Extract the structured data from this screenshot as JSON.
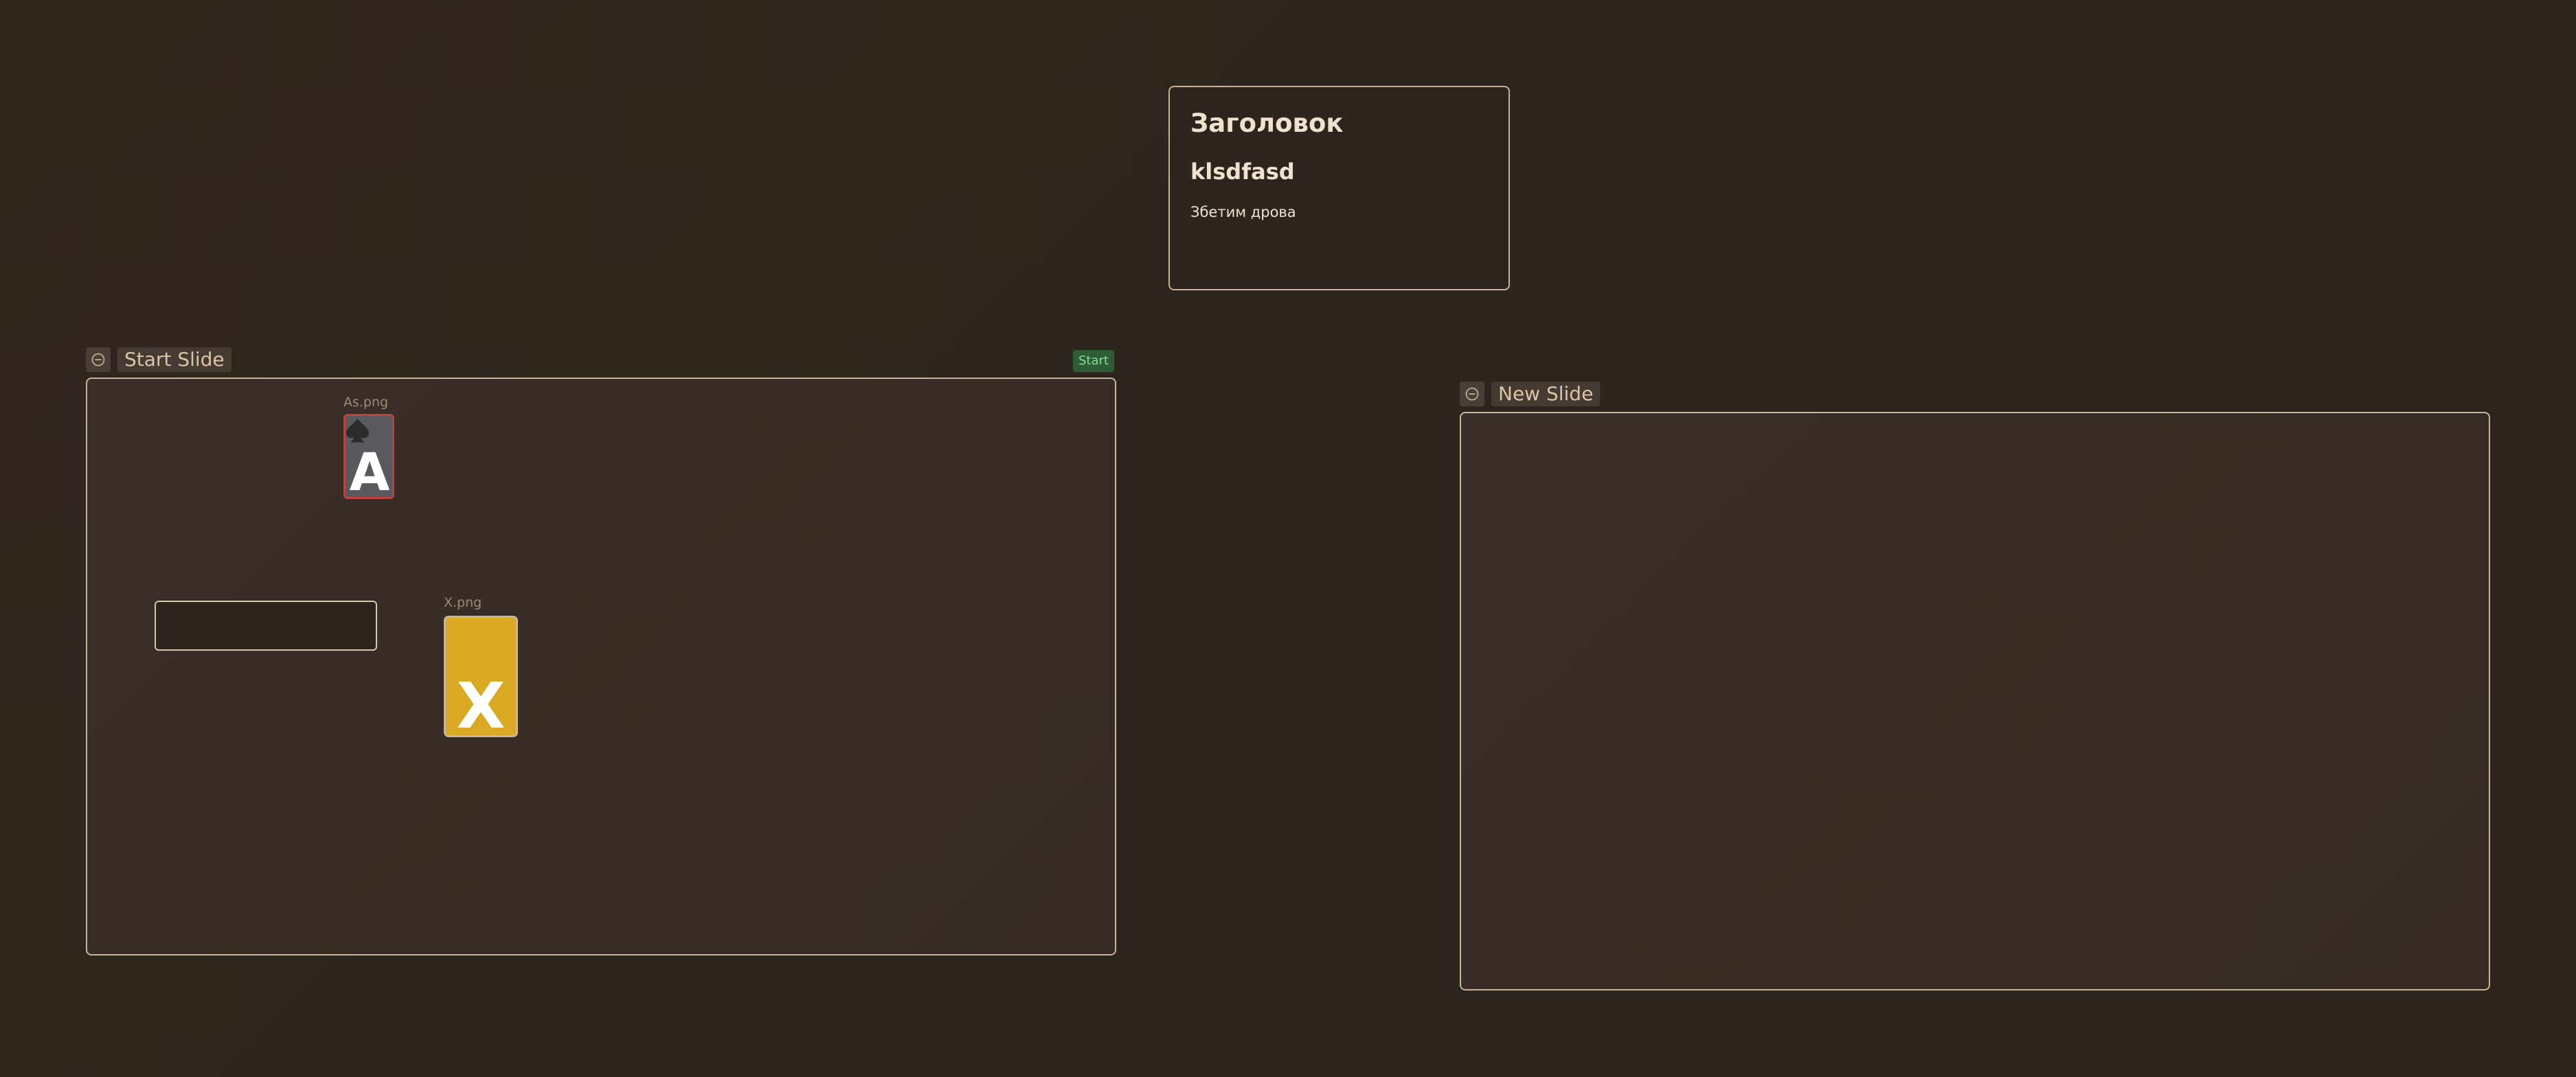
{
  "text_card": {
    "heading": "Заголовок",
    "subheading": "klsdfasd",
    "body": "Збетим дрова"
  },
  "slides": [
    {
      "title": "Start Slide",
      "badge": "Start",
      "images": [
        {
          "label": "As.png",
          "glyph": "A",
          "icon": "spade-icon"
        },
        {
          "label": "X.png",
          "glyph": "X"
        }
      ]
    },
    {
      "title": "New Slide"
    }
  ],
  "colors": {
    "background": "#2f261f",
    "frame_border": "#c9b49a",
    "badge_bg": "#2e5c36",
    "badge_text": "#86e08f",
    "card_x_fill": "#d9a924",
    "card_ace_fill": "#5a5a5e",
    "card_ace_border": "#c0413c"
  },
  "icons": {
    "collapse": "minus-circle-icon"
  }
}
